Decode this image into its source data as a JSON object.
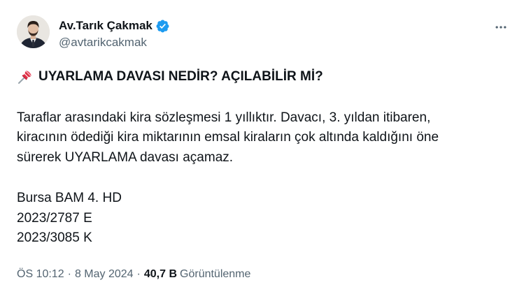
{
  "author": {
    "display_name": "Av.Tarık Çakmak",
    "handle": "@avtarikcakmak",
    "verified": true
  },
  "tweet": {
    "headline": "UYARLAMA DAVASI NEDİR? AÇILABİLİR Mİ?",
    "paragraph1": "Taraflar arasındaki kira sözleşmesi 1 yıllıktır. Davacı, 3. yıldan itibaren,\nkiracının ödediği kira miktarının emsal kiraların çok altında kaldığını öne\nsürerek UYARLAMA davası açamaz.",
    "paragraph2": "Bursa BAM 4. HD\n2023/2787 E\n2023/3085 K"
  },
  "meta": {
    "time": "ÖS 10:12",
    "date": "8 May 2024",
    "separator": "·",
    "views_count": "40,7 B",
    "views_label": "Görüntülenme"
  },
  "colors": {
    "text_primary": "#0f1419",
    "text_secondary": "#536471",
    "verified_blue": "#1d9bf0",
    "pin_red": "#e0245e"
  },
  "icons": {
    "verified": "verified-badge-icon",
    "more": "more-horizontal-icon",
    "pin": "pushpin-icon"
  }
}
